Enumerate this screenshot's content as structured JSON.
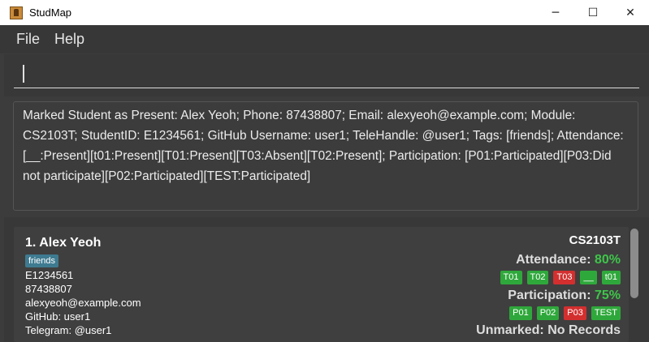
{
  "window": {
    "title": "StudMap",
    "controls": {
      "minimize": "─",
      "maximize": "☐",
      "close": "✕"
    }
  },
  "menu": {
    "file": "File",
    "help": "Help"
  },
  "command": {
    "value": "",
    "placeholder": ""
  },
  "result": {
    "text": "Marked Student as Present: Alex Yeoh; Phone: 87438807; Email: alexyeoh@example.com; Module: CS2103T; StudentID: E1234561; GitHub Username: user1; TeleHandle: @user1; Tags: [friends]; Attendance: [__:Present][t01:Present][T01:Present][T03:Absent][T02:Present]; Participation: [P01:Participated][P03:Did not participate][P02:Participated][TEST:Participated]"
  },
  "student": {
    "name_line": "1.  Alex Yeoh",
    "tag": "friends",
    "student_id": "E1234561",
    "phone": "87438807",
    "email": "alexyeoh@example.com",
    "github": "GitHub: user1",
    "telegram": "Telegram: @user1",
    "module": "CS2103T",
    "attendance_label": "Attendance: ",
    "attendance_pct": "80%",
    "attendance_badges": [
      {
        "label": "T01",
        "status": "present"
      },
      {
        "label": "T02",
        "status": "present"
      },
      {
        "label": "T03",
        "status": "absent"
      },
      {
        "label": "__",
        "status": "present"
      },
      {
        "label": "t01",
        "status": "present"
      }
    ],
    "participation_label": "Participation: ",
    "participation_pct": "75%",
    "participation_badges": [
      {
        "label": "P01",
        "status": "participated"
      },
      {
        "label": "P02",
        "status": "participated"
      },
      {
        "label": "P03",
        "status": "not-participated"
      },
      {
        "label": "TEST",
        "status": "participated"
      }
    ],
    "unmarked_label": "Unmarked: ",
    "unmarked_value": "No Records"
  },
  "colors": {
    "present": "#2fa83b",
    "absent": "#d32f2f",
    "percent": "#3fc54a",
    "tag": "#3e7b91"
  }
}
